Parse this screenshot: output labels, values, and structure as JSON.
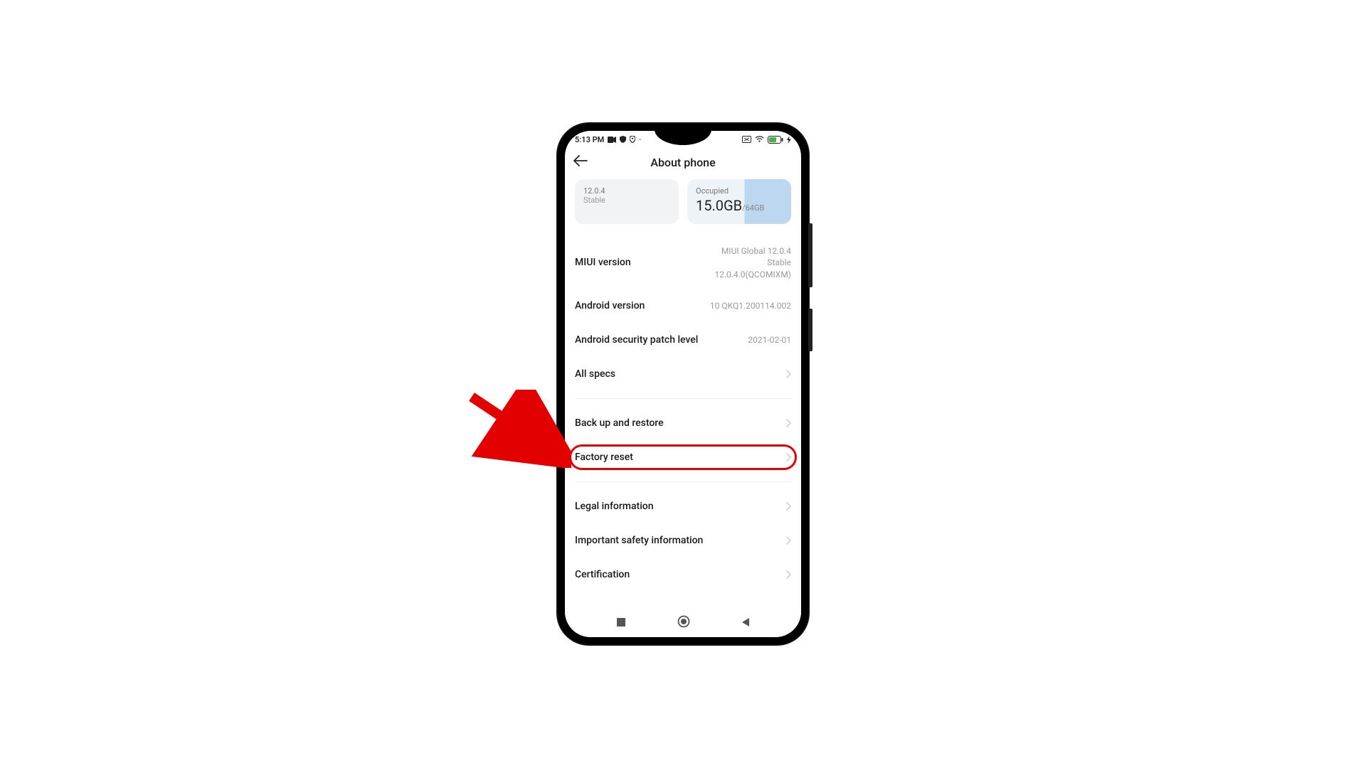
{
  "status": {
    "time": "5:13 PM"
  },
  "header": {
    "title": "About phone"
  },
  "cards": {
    "version": {
      "line1": "12.0.4",
      "line2": "Stable"
    },
    "storage": {
      "caption": "Occupied",
      "used": "15.0GB",
      "total": "/64GB"
    }
  },
  "rows": {
    "miui": {
      "label": "MIUI version",
      "value1": "MIUI Global 12.0.4",
      "value2": "Stable",
      "value3": "12.0.4.0(QCOMIXM)"
    },
    "android": {
      "label": "Android version",
      "value": "10 QKQ1.200114.002"
    },
    "security": {
      "label": "Android security patch level",
      "value": "2021-02-01"
    },
    "allspecs": {
      "label": "All specs"
    },
    "backup": {
      "label": "Back up and restore"
    },
    "factory": {
      "label": "Factory reset"
    },
    "legal": {
      "label": "Legal information"
    },
    "safety": {
      "label": "Important safety information"
    },
    "cert": {
      "label": "Certification"
    }
  }
}
